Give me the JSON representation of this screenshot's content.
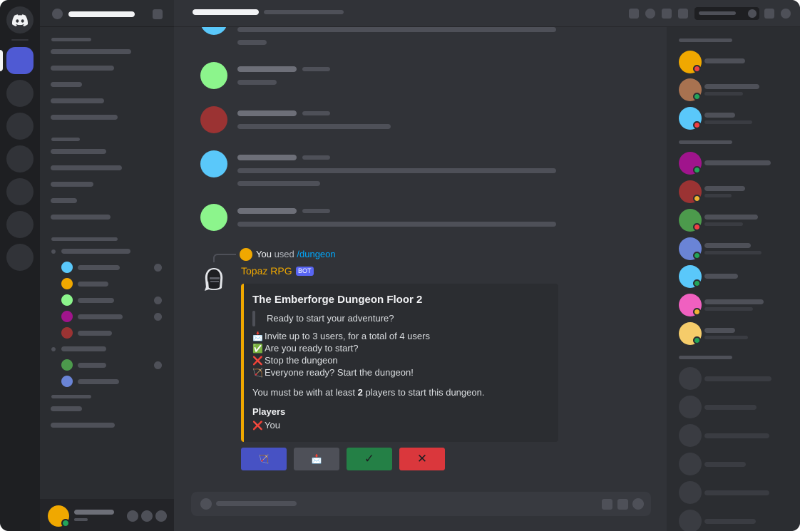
{
  "slash_command": {
    "user": "You",
    "verb": "used",
    "command": "/dungeon"
  },
  "bot": {
    "name": "Topaz RPG",
    "badge": "BOT"
  },
  "embed": {
    "title": "The Emberforge Dungeon Floor 2",
    "quote": "Ready to start your adventure?",
    "lines": [
      {
        "icon": "📩",
        "icon_name": "envelope-icon",
        "text": "Invite up to 3 users, for a total of 4 users"
      },
      {
        "icon": "✅",
        "icon_name": "check-mark-icon",
        "text": "Are you ready to start?"
      },
      {
        "icon": "❌",
        "icon_name": "cross-mark-icon",
        "text": "Stop the dungeon"
      },
      {
        "icon": "🏹",
        "icon_name": "bow-and-arrow-icon",
        "text": "Everyone ready? Start the dungeon!"
      }
    ],
    "requirement_prefix": "You must be with at least ",
    "requirement_count": "2",
    "requirement_suffix": " players to start this dungeon.",
    "players_heading": "Players",
    "players": [
      {
        "icon": "❌",
        "name": "You"
      }
    ],
    "accent_color": "#f0a800"
  },
  "action_buttons": [
    {
      "icon": "🏹",
      "icon_name": "bow-and-arrow-icon",
      "color": "#4752c4"
    },
    {
      "icon": "📩",
      "icon_name": "envelope-icon",
      "color": "#4e5058"
    },
    {
      "icon": "✓",
      "icon_name": "check-icon",
      "color": "#248046"
    },
    {
      "icon": "✕",
      "icon_name": "close-icon",
      "color": "#da373c"
    }
  ],
  "colors": {
    "link": "#00a8fc",
    "bot_name": "#f0a800",
    "bot_badge": "#5865f2"
  }
}
